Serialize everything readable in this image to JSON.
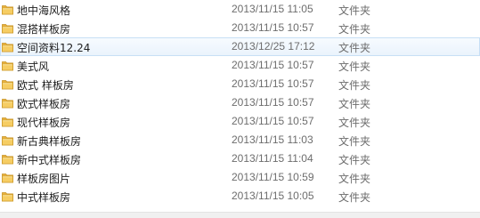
{
  "file_list": {
    "rows": [
      {
        "name": "地中海风格",
        "date_modified": "2013/11/15 11:05",
        "type": "文件夹",
        "icon": "folder-icon",
        "selected": false
      },
      {
        "name": "混搭样板房",
        "date_modified": "2013/11/15 10:57",
        "type": "文件夹",
        "icon": "folder-icon",
        "selected": false
      },
      {
        "name": "空间资料12.24",
        "date_modified": "2013/12/25 17:12",
        "type": "文件夹",
        "icon": "folder-icon",
        "selected": true
      },
      {
        "name": "美式风",
        "date_modified": "2013/11/15 10:57",
        "type": "文件夹",
        "icon": "folder-icon",
        "selected": false
      },
      {
        "name": "欧式 样板房",
        "date_modified": "2013/11/15 10:57",
        "type": "文件夹",
        "icon": "folder-icon",
        "selected": false
      },
      {
        "name": "欧式样板房",
        "date_modified": "2013/11/15 10:57",
        "type": "文件夹",
        "icon": "folder-icon",
        "selected": false
      },
      {
        "name": "现代样板房",
        "date_modified": "2013/11/15 10:57",
        "type": "文件夹",
        "icon": "folder-icon",
        "selected": false
      },
      {
        "name": "新古典样板房",
        "date_modified": "2013/11/15 11:03",
        "type": "文件夹",
        "icon": "folder-icon",
        "selected": false
      },
      {
        "name": "新中式样板房",
        "date_modified": "2013/11/15 11:04",
        "type": "文件夹",
        "icon": "folder-icon",
        "selected": false
      },
      {
        "name": "样板房图片",
        "date_modified": "2013/11/15 10:59",
        "type": "文件夹",
        "icon": "folder-icon",
        "selected": false
      },
      {
        "name": "中式样板房",
        "date_modified": "2013/11/15 10:05",
        "type": "文件夹",
        "icon": "folder-icon",
        "selected": false
      }
    ]
  },
  "colors": {
    "selection_fill": "#eaf3fc",
    "selection_border": "#c7dff5",
    "folder_yellow": "#f4c55a",
    "secondary_text": "#6d6d6d"
  }
}
